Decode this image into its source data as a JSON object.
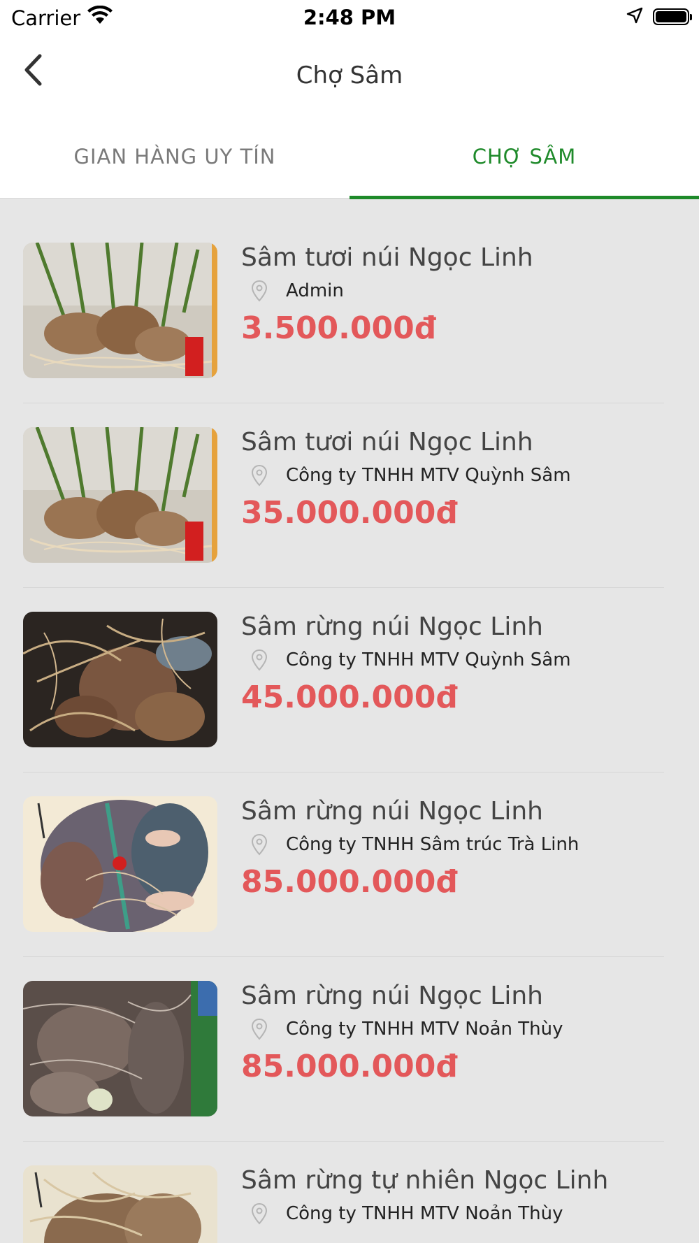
{
  "status_bar": {
    "carrier": "Carrier",
    "time": "2:48 PM"
  },
  "nav": {
    "title": "Chợ Sâm",
    "back_icon": "chevron-left-icon"
  },
  "tabs": [
    {
      "label": "GIAN HÀNG UY TÍN",
      "active": false
    },
    {
      "label": "CHỢ SÂM",
      "active": true
    }
  ],
  "colors": {
    "accent": "#1e8a2a",
    "price": "#e3585a",
    "background": "#e6e6e6"
  },
  "products": [
    {
      "name": "Sâm tươi núi Ngọc Linh",
      "seller": "Admin",
      "price": "3.500.000đ"
    },
    {
      "name": "Sâm tươi núi Ngọc Linh",
      "seller": "Công ty TNHH MTV Quỳnh Sâm",
      "price": "35.000.000đ"
    },
    {
      "name": "Sâm rừng núi Ngọc Linh",
      "seller": "Công ty TNHH MTV Quỳnh Sâm",
      "price": "45.000.000đ"
    },
    {
      "name": "Sâm rừng núi Ngọc Linh",
      "seller": "Công ty TNHH Sâm trúc Trà Linh",
      "price": "85.000.000đ"
    },
    {
      "name": "Sâm rừng núi Ngọc Linh",
      "seller": "Công ty TNHH MTV Noản Thùy",
      "price": "85.000.000đ"
    },
    {
      "name": "Sâm rừng tự nhiên Ngọc Linh",
      "seller": "Công ty TNHH MTV Noản Thùy",
      "price": ""
    }
  ]
}
